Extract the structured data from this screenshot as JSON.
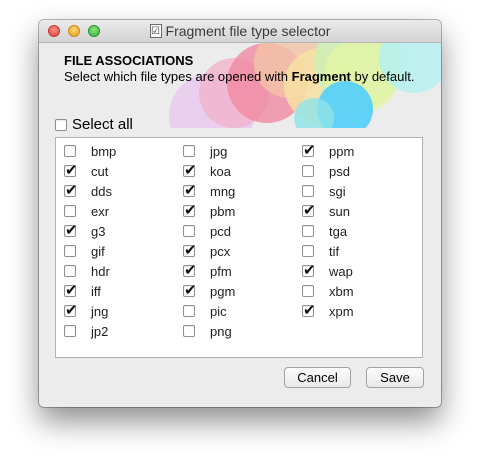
{
  "window": {
    "title": "Fragment file type selector"
  },
  "header": {
    "title": "FILE ASSOCIATIONS",
    "desc_prefix": "Select which file types are opened with ",
    "app_name": "Fragment",
    "desc_suffix": " by default."
  },
  "select_all": {
    "label": "Select all",
    "checked": false
  },
  "columns": [
    [
      {
        "name": "bmp",
        "checked": false
      },
      {
        "name": "cut",
        "checked": true
      },
      {
        "name": "dds",
        "checked": true
      },
      {
        "name": "exr",
        "checked": false
      },
      {
        "name": "g3",
        "checked": true
      },
      {
        "name": "gif",
        "checked": false
      },
      {
        "name": "hdr",
        "checked": false
      },
      {
        "name": "iff",
        "checked": true
      },
      {
        "name": "jng",
        "checked": true
      },
      {
        "name": "jp2",
        "checked": false
      }
    ],
    [
      {
        "name": "jpg",
        "checked": false
      },
      {
        "name": "koa",
        "checked": true
      },
      {
        "name": "mng",
        "checked": true
      },
      {
        "name": "pbm",
        "checked": true
      },
      {
        "name": "pcd",
        "checked": false
      },
      {
        "name": "pcx",
        "checked": true
      },
      {
        "name": "pfm",
        "checked": true
      },
      {
        "name": "pgm",
        "checked": true
      },
      {
        "name": "pic",
        "checked": false
      },
      {
        "name": "png",
        "checked": false
      }
    ],
    [
      {
        "name": "ppm",
        "checked": true
      },
      {
        "name": "psd",
        "checked": false
      },
      {
        "name": "sgi",
        "checked": false
      },
      {
        "name": "sun",
        "checked": true
      },
      {
        "name": "tga",
        "checked": false
      },
      {
        "name": "tif",
        "checked": false
      },
      {
        "name": "wap",
        "checked": true
      },
      {
        "name": "xbm",
        "checked": false
      },
      {
        "name": "xpm",
        "checked": true
      }
    ]
  ],
  "buttons": {
    "cancel": "Cancel",
    "save": "Save"
  },
  "colors": {
    "window_bg": "#ececec",
    "check": "#111111"
  }
}
